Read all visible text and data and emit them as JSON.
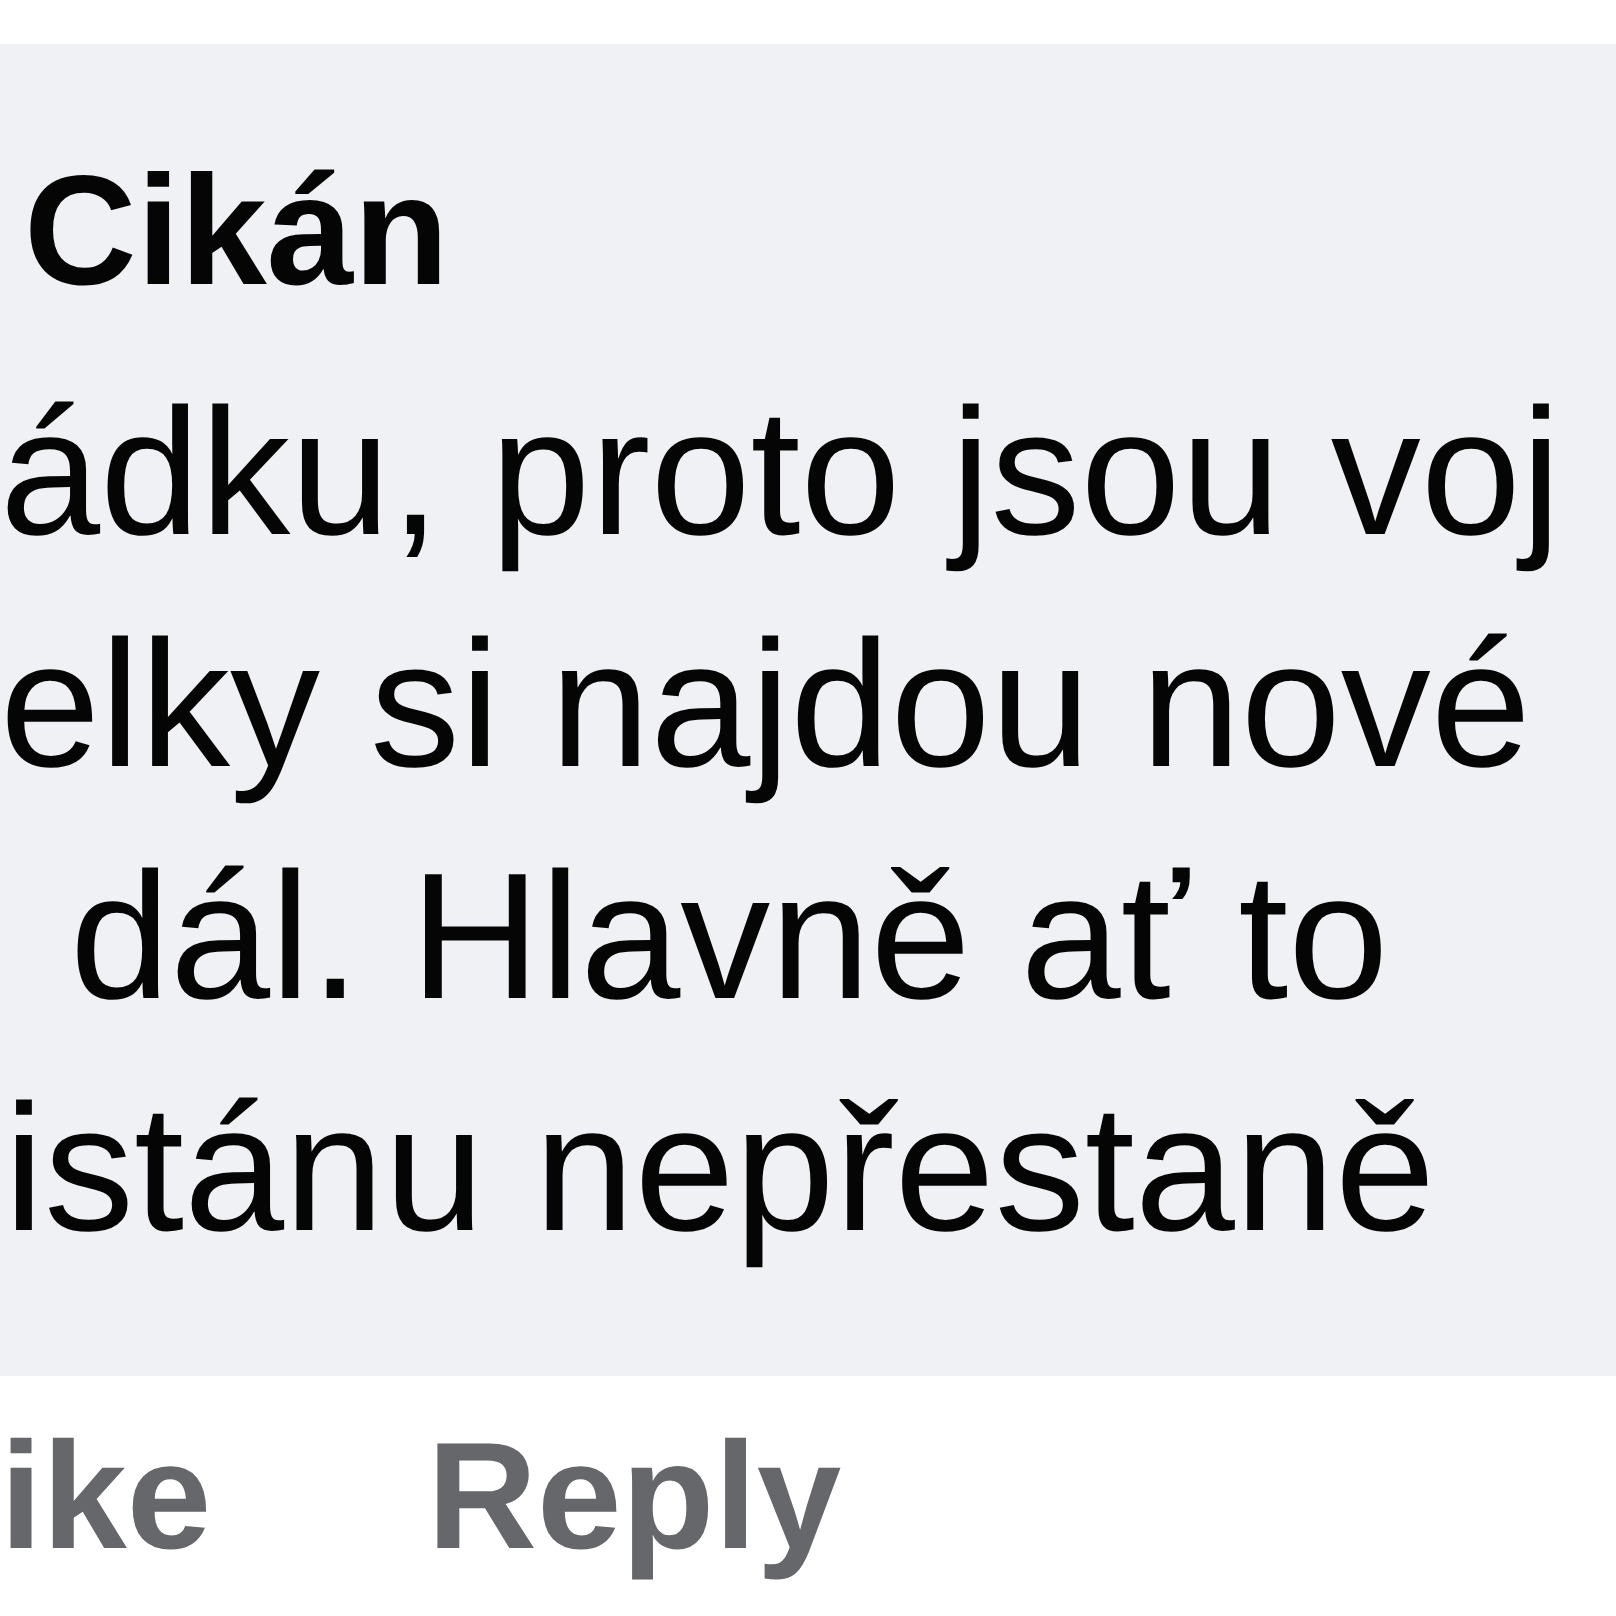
{
  "comment": {
    "author": "Cikán",
    "text_lines": [
      "ádku, proto jsou voj",
      "elky si najdou nové",
      "dál. Hlavně ať to",
      "istánu nepřestaně"
    ]
  },
  "actions": [
    "ike",
    "Reply"
  ]
}
